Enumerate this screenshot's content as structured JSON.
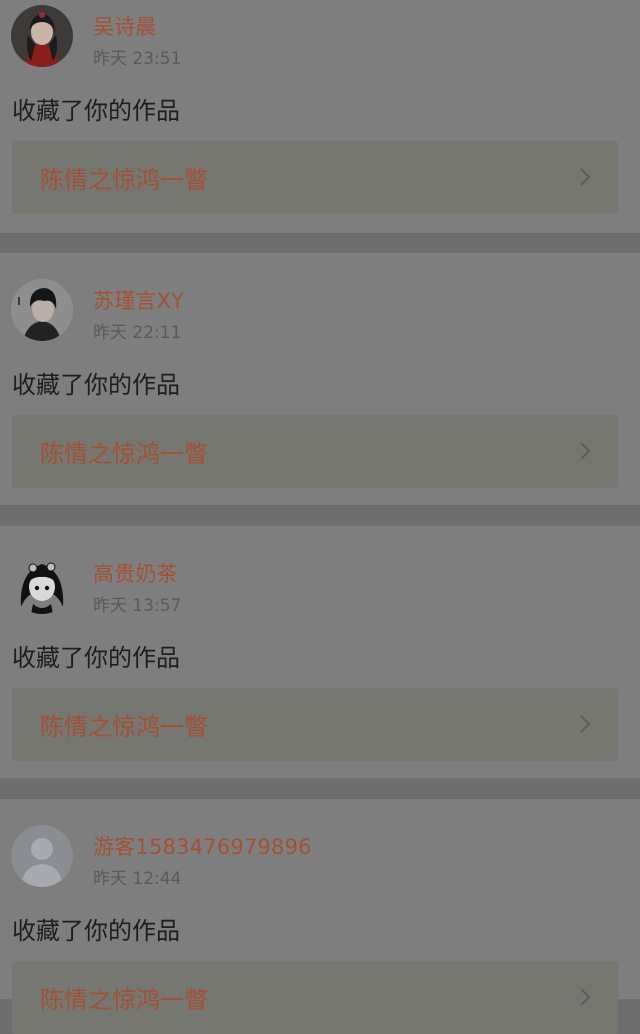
{
  "notifications": [
    {
      "user": "吴诗晨",
      "time": "昨天 23:51",
      "action": "收藏了你的作品",
      "work_title": "陈情之惊鸿一瞥",
      "avatar_icon": "avatar-red-costume-girl"
    },
    {
      "user": "苏瑾言XY",
      "time": "昨天 22:11",
      "action": "收藏了你的作品",
      "work_title": "陈情之惊鸿一瞥",
      "avatar_icon": "avatar-boy-dark-hair"
    },
    {
      "user": "高贵奶茶",
      "time": "昨天 13:57",
      "action": "收藏了你的作品",
      "work_title": "陈情之惊鸿一瞥",
      "avatar_icon": "avatar-anime-girl"
    },
    {
      "user": "游客1583476979896",
      "time": "昨天 12:44",
      "action": "收藏了你的作品",
      "work_title": "陈情之惊鸿一瞥",
      "avatar_icon": "avatar-default-guest"
    }
  ],
  "colors": {
    "accent": "#a45133",
    "card_bg": "#7e7e7e",
    "divider_bg": "#6e6e6e"
  }
}
